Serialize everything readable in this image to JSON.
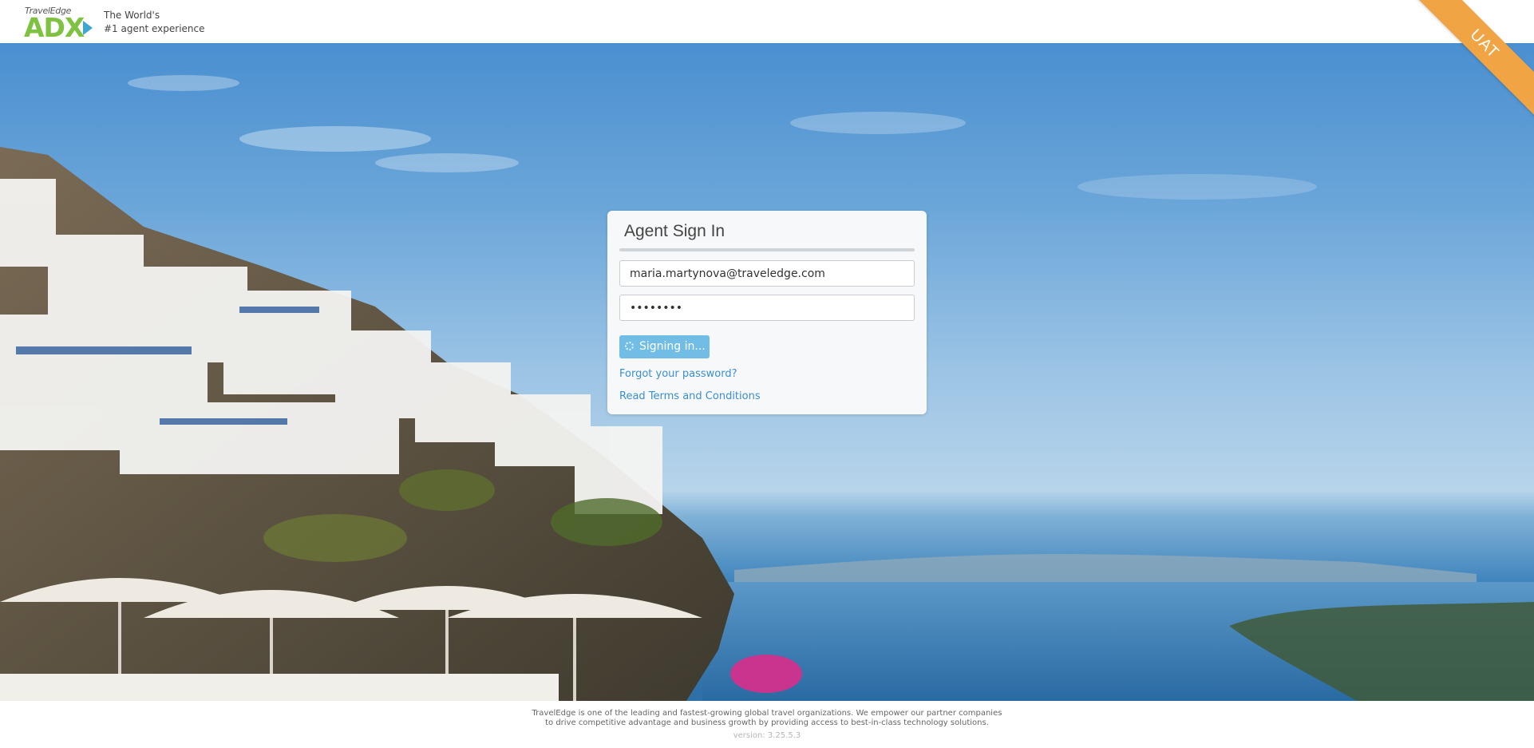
{
  "header": {
    "logo": {
      "brand_small": "TravelEdge",
      "brand_big": "ADX"
    },
    "tagline_line1": "The World's",
    "tagline_line2": "#1 agent experience"
  },
  "environment_badge": "UAT",
  "signin": {
    "title": "Agent Sign In",
    "email_value": "maria.martynova@traveledge.com",
    "password_value": "••••••••",
    "button_label": "Signing in...",
    "forgot_link": "Forgot your password?",
    "terms_link": "Read Terms and Conditions"
  },
  "footer": {
    "line1": "TravelEdge is one of the leading and fastest-growing global travel organizations. We empower our partner companies",
    "line2": "to drive competitive advantage and business growth by providing access to best-in-class technology solutions.",
    "version": "version: 3.25.5.3"
  },
  "colors": {
    "brand_green": "#7fc241",
    "brand_blue": "#3fa7cf",
    "uat_orange": "#f0a444",
    "button_blue": "#72bde6",
    "link_blue": "#3a8fd0"
  },
  "icons": {
    "logo_arrow": "arrow-right-icon",
    "button_spinner": "spinner-icon"
  }
}
